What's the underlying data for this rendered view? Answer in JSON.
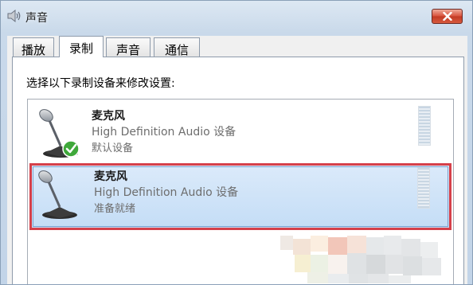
{
  "window": {
    "title": "声音",
    "icons": {
      "app": "speaker-icon",
      "close": "close-icon"
    }
  },
  "tabs": [
    {
      "label": "播放",
      "active": false
    },
    {
      "label": "录制",
      "active": true
    },
    {
      "label": "声音",
      "active": false
    },
    {
      "label": "通信",
      "active": false
    }
  ],
  "panel": {
    "instruction": "选择以下录制设备来修改设置:"
  },
  "devices": [
    {
      "name": "麦克风",
      "driver": "High Definition Audio 设备",
      "status": "默认设备",
      "icon": "microphone-icon",
      "badge": "default-check-icon",
      "selected": false
    },
    {
      "name": "麦克风",
      "driver": "High Definition Audio 设备",
      "status": "准备就绪",
      "icon": "microphone-icon",
      "selected": true
    }
  ],
  "colors": {
    "selection_highlight": "#d5404a",
    "selected_row": "#c4ddf6",
    "close_button": "#d8503a"
  }
}
